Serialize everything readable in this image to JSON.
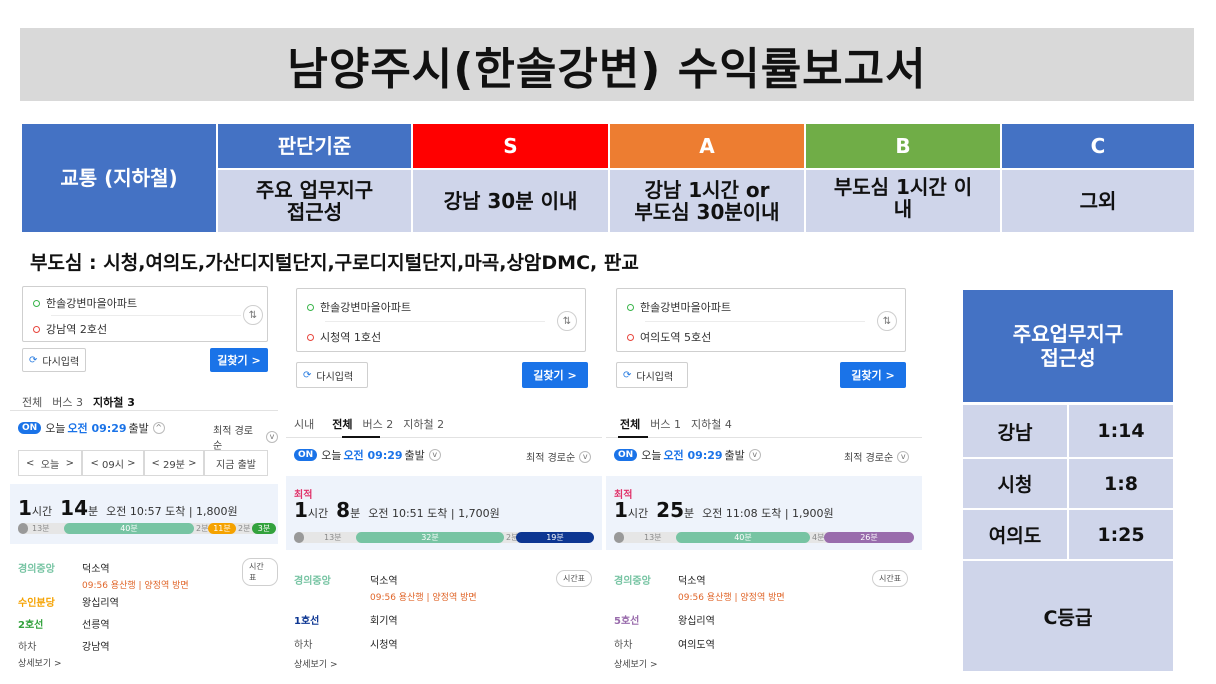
{
  "title": "남양주시(한솔강변) 수익률보고서",
  "criteria": {
    "row_label": "교통 (지하철)",
    "header": [
      "판단기준",
      "S",
      "A",
      "B",
      "C"
    ],
    "header_colors": [
      "#4472c4",
      "#ff0000",
      "#ed7d31",
      "#70ad47",
      "#4472c4"
    ],
    "body_line1": [
      "주요 업무지구",
      "강남 30분 이내",
      "강남 1시간 or",
      "부도심 1시간 이",
      "그외"
    ],
    "body_line2": [
      "접근성",
      "",
      "부도심 30분이내",
      "내",
      ""
    ]
  },
  "subtitle": "부도심 : 시청,여의도,가산디지털단지,구로디지털단지,마곡,상암DMC,  판교",
  "panels": [
    {
      "from": "한솔강변마을아파트",
      "to": "강남역 2호선",
      "reset": "다시입력",
      "go": "길찾기 >",
      "tabs": [
        "전체",
        "버스 3",
        "지하철 3"
      ],
      "depart_prefix": "오늘",
      "depart_time": "오전 09:29",
      "depart_suffix": "출발",
      "sort": "최적 경로순",
      "timepick": [
        "<",
        "오늘",
        ">",
        "<",
        "09시",
        ">",
        "<",
        "29분",
        ">",
        "지금 출발"
      ],
      "best": "",
      "dur_h": "1",
      "dur_hl": "시간",
      "dur_m": "14",
      "dur_ml": "분",
      "arrive": "오전 10:57 도착",
      "fare": "1,800원",
      "segs": [
        "13분",
        "40분",
        "2분",
        "11분",
        "2분",
        "3분"
      ],
      "steps": [
        {
          "line": "경의중앙",
          "station": "덕소역",
          "sub": "09:56 용산행 | 양정역 방면"
        },
        {
          "line": "수인분당",
          "station": "왕십리역",
          "sub": ""
        },
        {
          "line": "2호선",
          "station": "선릉역",
          "sub": ""
        },
        {
          "line": "하차",
          "station": "강남역",
          "sub": ""
        }
      ],
      "timetable": "시간표",
      "more": "상세보기 >"
    },
    {
      "from": "한솔강변마을아파트",
      "to": "시청역 1호선",
      "reset": "다시입력",
      "go": "길찾기 >",
      "tabs": [
        "시내",
        "전체",
        "버스 2",
        "지하철 2"
      ],
      "depart_prefix": "오늘",
      "depart_time": "오전 09:29",
      "depart_suffix": "출발",
      "sort": "최적 경로순",
      "best": "최적",
      "dur_h": "1",
      "dur_hl": "시간",
      "dur_m": "8",
      "dur_ml": "분",
      "arrive": "오전 10:51 도착",
      "fare": "1,700원",
      "segs": [
        "13분",
        "32분",
        "2분",
        "19분"
      ],
      "steps": [
        {
          "line": "경의중앙",
          "station": "덕소역",
          "sub": "09:56 용산행 | 양정역 방면"
        },
        {
          "line": "1호선",
          "station": "회기역",
          "sub": ""
        },
        {
          "line": "하차",
          "station": "시청역",
          "sub": ""
        }
      ],
      "timetable": "시간표",
      "more": "상세보기 >"
    },
    {
      "from": "한솔강변마을아파트",
      "to": "여의도역 5호선",
      "reset": "다시입력",
      "go": "길찾기 >",
      "tabs": [
        "전체",
        "버스 1",
        "지하철 4"
      ],
      "depart_prefix": "오늘",
      "depart_time": "오전 09:29",
      "depart_suffix": "출발",
      "sort": "최적 경로순",
      "best": "최적",
      "dur_h": "1",
      "dur_hl": "시간",
      "dur_m": "25",
      "dur_ml": "분",
      "arrive": "오전 11:08 도착",
      "fare": "1,900원",
      "segs": [
        "13분",
        "40분",
        "4분",
        "26분"
      ],
      "steps": [
        {
          "line": "경의중앙",
          "station": "덕소역",
          "sub": "09:56 용산행 | 양정역 방면"
        },
        {
          "line": "5호선",
          "station": "왕십리역",
          "sub": ""
        },
        {
          "line": "하차",
          "station": "여의도역",
          "sub": ""
        }
      ],
      "timetable": "시간표",
      "more": "상세보기 >"
    }
  ],
  "summary": {
    "header_line1": "주요업무지구",
    "header_line2": "접근성",
    "rows": [
      {
        "area": "강남",
        "time": "1:14"
      },
      {
        "area": "시청",
        "time": "1:8"
      },
      {
        "area": "여의도",
        "time": "1:25"
      }
    ],
    "grade": "C등급"
  },
  "colors": {
    "accent_blue": "#4472c4",
    "table_body": "#cfd5ea",
    "line_gyeongui": "#77c4a3",
    "line_suin": "#f5a200",
    "line_2": "#33a23d",
    "line_1": "#0d3692",
    "line_5": "#996cac"
  }
}
